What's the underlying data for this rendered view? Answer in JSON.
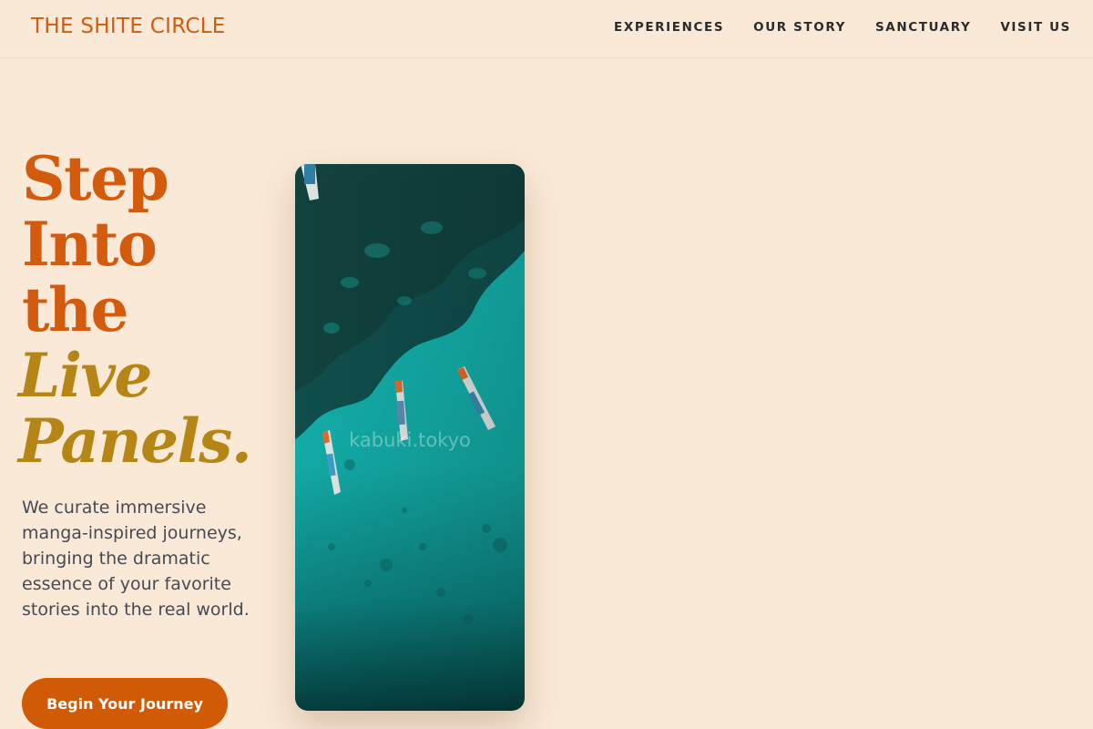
{
  "brand": "THE SHITE CIRCLE",
  "nav": [
    {
      "label": "EXPERIENCES"
    },
    {
      "label": "OUR STORY"
    },
    {
      "label": "SANCTUARY"
    },
    {
      "label": "VISIT US"
    }
  ],
  "hero": {
    "headline_lines": [
      "Step",
      "Into",
      "the"
    ],
    "headline_accent_lines": [
      "Live",
      "Panels."
    ],
    "description": "We curate immersive manga-inspired journeys, bringing the dramatic essence of your favorite stories into the real world.",
    "cta_label": "Begin Your Journey",
    "image_watermark": "kabuki.tokyo"
  },
  "colors": {
    "background": "#fae9d7",
    "brand": "#d35b0e",
    "accent": "#b58616",
    "button": "#d15a07",
    "text": "#454a55"
  }
}
